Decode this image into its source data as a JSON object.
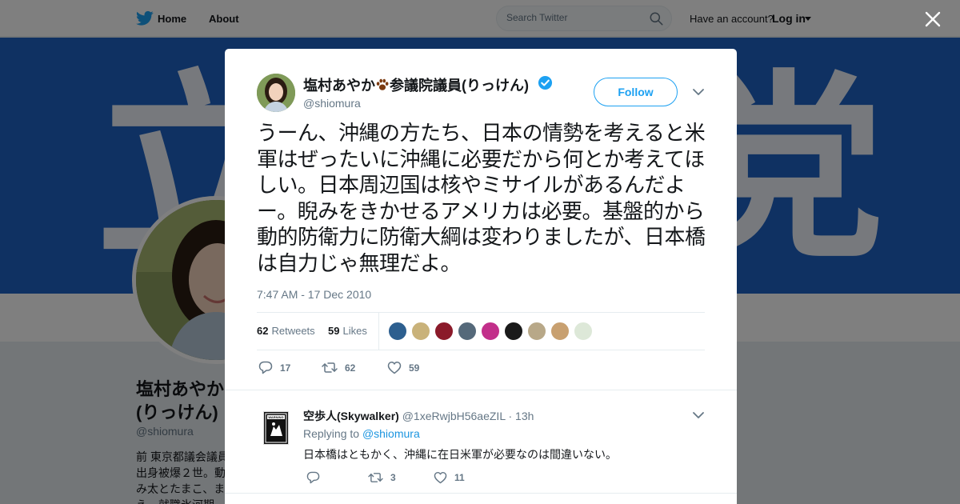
{
  "topbar": {
    "home_label": "Home",
    "about_label": "About",
    "search_placeholder": "Search Twitter",
    "have_account": "Have an account?",
    "login_label": "Log in"
  },
  "profile": {
    "banner_text_left": "立",
    "banner_text_right": "党",
    "name_line1": "塩村あやか",
    "name_line2": "(りっけん)",
    "handle": "@shiomura",
    "bio_lines": [
      "前 東京都議会議員",
      "出身被爆２世。動",
      "み太とたまこ、ま",
      "え　就職氷河期"
    ]
  },
  "tweet": {
    "author_name_part1": "塩村あやか",
    "author_name_part2": "参議院議員(りっけん)",
    "author_handle": "@shiomura",
    "follow_label": "Follow",
    "text": "うーん、沖縄の方たち、日本の情勢を考えると米軍はぜったいに沖縄に必要だから何とか考えてほしい。日本周辺国は核やミサイルがあるんだよー。睨みをきかせるアメリカは必要。基盤的から動的防衛力に防衛大綱は変わりましたが、日本橋は自力じゃ無理だよ。",
    "timestamp": "7:47 AM - 17 Dec 2010",
    "retweets_count": "62",
    "retweets_label": "Retweets",
    "likes_count": "59",
    "likes_label": "Likes",
    "liker_colors": [
      "#2d5f8f",
      "#c9b27a",
      "#8b1a2a",
      "#55697a",
      "#c22f8a",
      "#1a1a1a",
      "#b8a888",
      "#c8a070",
      "#dde8d8"
    ],
    "actions": {
      "reply_count": "17",
      "retweet_count": "62",
      "like_count": "59"
    }
  },
  "reply": {
    "name": "空歩人(Skywalker)",
    "handle": "@1xeRwjbH56aeZIL",
    "separator": "·",
    "time": "13h",
    "replying_to_label": "Replying to",
    "replying_to_handle": "@shiomura",
    "text": "日本橋はともかく、沖縄に在日米軍が必要なのは間違いない。",
    "avatar_sign_text": "WARNING",
    "actions": {
      "reply_count": "",
      "retweet_count": "3",
      "like_count": "11"
    }
  },
  "colors": {
    "twitter_blue": "#1da1f2",
    "banner_blue": "#1e62c5",
    "secondary_text": "#657786"
  }
}
